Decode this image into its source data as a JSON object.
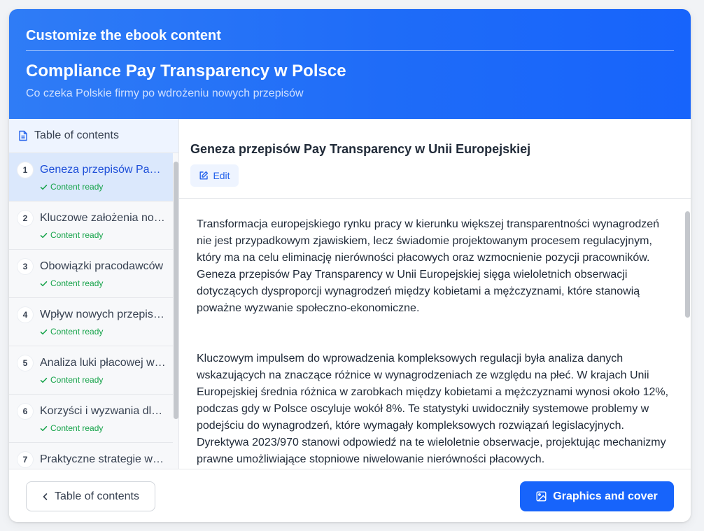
{
  "colors": {
    "accent": "#1764fb",
    "header_gradient_start": "#2f7cf6",
    "active_item_bg": "#dbe8fc",
    "status_green": "#16a34a"
  },
  "header": {
    "overline": "Customize the ebook content",
    "title": "Compliance Pay Transparency w Polsce",
    "subtitle": "Co czeka Polskie firmy po wdrożeniu nowych przepisów"
  },
  "sidebar": {
    "heading": "Table of contents",
    "heading_icon": "document-icon",
    "items": [
      {
        "num": "1",
        "label": "Geneza przepisów Pay Transparency w Unii Europejskiej",
        "status": "Content ready",
        "active": true
      },
      {
        "num": "2",
        "label": "Kluczowe założenia nowych przepisów",
        "status": "Content ready"
      },
      {
        "num": "3",
        "label": "Obowiązki pracodawców",
        "status": "Content ready"
      },
      {
        "num": "4",
        "label": "Wpływ nowych przepisów",
        "status": "Content ready"
      },
      {
        "num": "5",
        "label": "Analiza luki płacowej w Polsce",
        "status": "Content ready"
      },
      {
        "num": "6",
        "label": "Korzyści i wyzwania dla firm",
        "status": "Content ready"
      },
      {
        "num": "7",
        "label": "Praktyczne strategie wdrożenia",
        "status": ""
      }
    ]
  },
  "main": {
    "section_title": "Geneza przepisów Pay Transparency w Unii Europejskiej",
    "edit_label": "Edit",
    "paragraphs": [
      "Transformacja europejskiego rynku pracy w kierunku większej transparentności wynagrodzeń nie jest przypadkowym zjawiskiem, lecz świadomie projektowanym procesem regulacyjnym, który ma na celu eliminację nierówności płacowych oraz wzmocnienie pozycji pracowników. Geneza przepisów Pay Transparency w Unii Europejskiej sięga wieloletnich obserwacji dotyczących dysproporcji wynagrodzeń między kobietami a mężczyznami, które stanowią poważne wyzwanie społeczno-ekonomiczne.",
      "Kluczowym impulsem do wprowadzenia kompleksowych regulacji była analiza danych wskazujących na znaczące różnice w wynagrodzeniach ze względu na płeć. W krajach Unii Europejskiej średnia różnica w zarobkach między kobietami a mężczyznami wynosi około 12%, podczas gdy w Polsce oscyluje wokół 8%. Te statystyki uwidoczniły systemowe problemy w podejściu do wynagrodzeń, które wymagały kompleksowych rozwiązań legislacyjnych. Dyrektywa 2023/970 stanowi odpowiedź na te wieloletnie obserwacje, projektując mechanizmy prawne umożliwiające stopniowe niwelowanie nierówności płacowych."
    ]
  },
  "footer": {
    "back_label": "Table of contents",
    "next_label": "Graphics and cover"
  }
}
